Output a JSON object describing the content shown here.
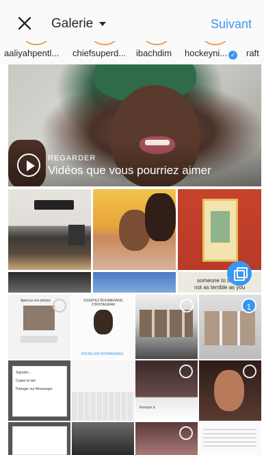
{
  "header": {
    "title": "Galerie",
    "next_label": "Suivant"
  },
  "stories": [
    {
      "name": "aaliyahpentl..."
    },
    {
      "name": "chiefsuperd..."
    },
    {
      "name": "ibachdim"
    },
    {
      "name": "hockeyni...",
      "verified": true
    },
    {
      "name": "raft"
    }
  ],
  "hero": {
    "kicker": "REGARDER",
    "title": "Vidéos que vous pourriez aimer"
  },
  "grid": {
    "thumb_texts": {
      "someone_line1": "someone to tell you",
      "someone_line2": "not as terrible as you",
      "cell5_heading": "Apercus vos photos",
      "cell6_heading": "ESSAYEZ BOOMERANG D'INSTAGRAM",
      "cell6_button": "INSTALLER BOOMERANG",
      "share_row1": "Signaler...",
      "share_row2": "Copier le lien",
      "share_row3": "Partager sur Messenger",
      "keyboard_bar": "Envoyer à"
    },
    "selected_count": "1"
  },
  "colors": {
    "accent": "#3897f0",
    "text": "#262626",
    "header_bg": "#fafafa"
  },
  "icons": {
    "close": "close-icon",
    "dropdown": "chevron-down-icon",
    "play": "play-icon",
    "multi_select": "multi-select-icon"
  }
}
